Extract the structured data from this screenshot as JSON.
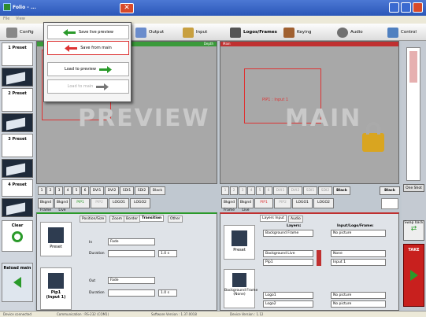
{
  "window": {
    "title": "Folio - ..."
  },
  "menubar": [
    "File",
    "View",
    "Help"
  ],
  "toolbar": [
    {
      "label": "Config",
      "icon": "gear-icon"
    },
    {
      "label": "Output",
      "icon": "monitor-icon"
    },
    {
      "label": "Input",
      "icon": "input-icon"
    },
    {
      "label": "Logos/Frames",
      "icon": "logo-icon"
    },
    {
      "label": "Keying",
      "icon": "key-icon"
    },
    {
      "label": "Audio",
      "icon": "audio-icon"
    },
    {
      "label": "Control",
      "icon": "control-icon"
    }
  ],
  "dropdown": {
    "items": [
      "Save live preview",
      "Save from main",
      "Load to preview",
      "Load to main"
    ]
  },
  "presets": [
    "1\nPreset",
    "2\nPreset",
    "3\nPreset",
    "4\nPreset"
  ],
  "preview": {
    "title": "Depth",
    "watermark": "PREVIEW",
    "buttons": [
      "1",
      "2",
      "3",
      "4",
      "5",
      "6",
      "DVI1",
      "DVI2",
      "SDI1",
      "SDI2",
      "Black"
    ],
    "bottom": [
      "Bkgnd Frame",
      "Bkgnd Live",
      "PIP1",
      "PIP2",
      "LOGO1",
      "LOGO2"
    ]
  },
  "main": {
    "title": "Main",
    "watermark": "MAIN",
    "pip_label": "PiP1 : Input 1",
    "buttons": [
      "1",
      "2",
      "3",
      "4",
      "5",
      "6",
      "DVI1",
      "DVI2",
      "SDI1",
      "SDI2",
      "Black"
    ],
    "bottom": [
      "Bkgnd Frame",
      "Bkgnd Live",
      "PIP1",
      "PIP2",
      "LOGO1",
      "LOGO2"
    ]
  },
  "left_tools": {
    "clear": "Clear",
    "reload": "Reload main"
  },
  "pip_panel": {
    "preset": "Preset",
    "pip1": "Pip1\n(Input 1)",
    "tabs": [
      "Position/Size",
      "Zoom",
      "Border",
      "Transition",
      "Other"
    ],
    "in_label": "In",
    "in_value": "Fade",
    "in_duration_label": "Duration",
    "in_duration": "1.0 s",
    "out_label": "Out",
    "out_value": "Fade",
    "out_duration_label": "Duration",
    "out_duration": "1.0 s"
  },
  "layers_panel": {
    "preset": "Preset",
    "bg_frame": "Background Frame\n(None)",
    "tabs": [
      "Layers Input",
      "Audio"
    ],
    "col_layers": "Layers:",
    "col_input": "Input/Logo/Frame:",
    "rows": [
      {
        "layer": "Background Frame",
        "value": "No picture"
      },
      {
        "layer": "Background Live",
        "value": "None"
      },
      {
        "layer": "Pip1",
        "value": "Input 1"
      },
      {
        "layer": "Logo1",
        "value": "No picture"
      },
      {
        "layer": "Logo2",
        "value": "No picture"
      }
    ]
  },
  "right": {
    "black": "Black",
    "one_shot": "One Shot",
    "swap": "Swap back",
    "take": "TAKE"
  },
  "status": {
    "device": "Device connected",
    "comm": "Communication : RS-232 (COM1)",
    "software": "Software Version : 1.37.0018",
    "devver": "Device Version : 1.12"
  },
  "colors": {
    "accent_green": "#2a9a2a",
    "accent_red": "#d33",
    "take": "#c8201e"
  }
}
